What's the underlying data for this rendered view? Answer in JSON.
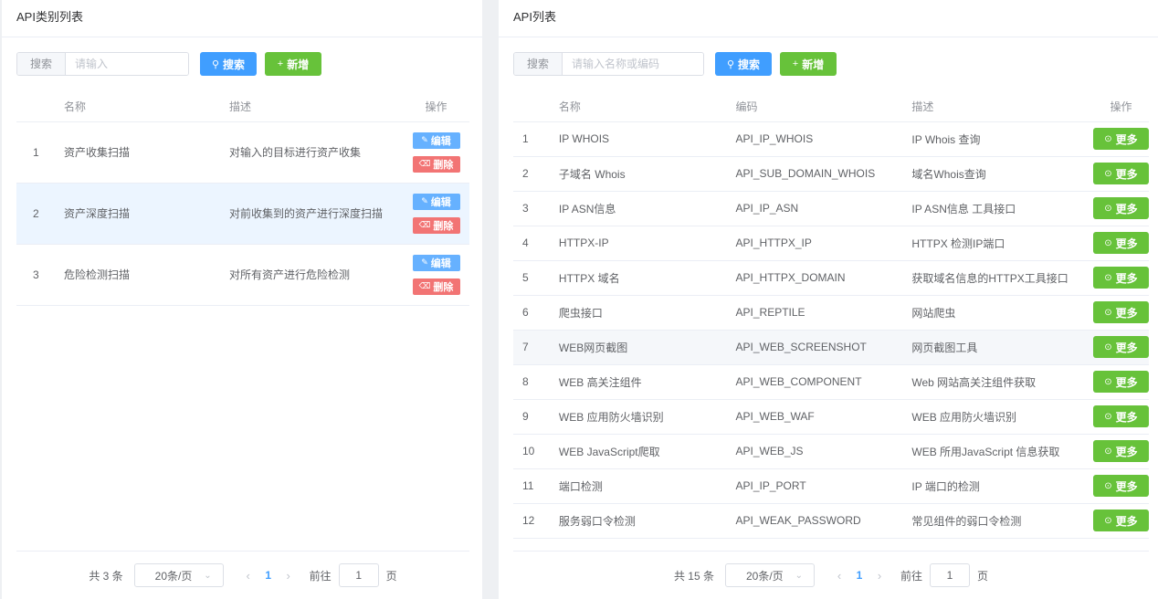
{
  "left": {
    "title": "API类别列表",
    "search": {
      "label": "搜索",
      "placeholder": "请输入",
      "value": ""
    },
    "search_btn": "搜索",
    "add_btn": "新增",
    "columns": [
      "名称",
      "描述",
      "操作"
    ],
    "rows": [
      {
        "idx": "1",
        "name": "资产收集扫描",
        "desc": "对输入的目标进行资产收集"
      },
      {
        "idx": "2",
        "name": "资产深度扫描",
        "desc": "对前收集到的资产进行深度扫描"
      },
      {
        "idx": "3",
        "name": "危险检测扫描",
        "desc": "对所有资产进行危险检测"
      }
    ],
    "edit_label": "编辑",
    "delete_label": "删除",
    "pager": {
      "total": "共 3 条",
      "page_size": "20条/页",
      "current": "1",
      "goto_label": "前往",
      "goto_value": "1",
      "page_suffix": "页"
    }
  },
  "right": {
    "title": "API列表",
    "search": {
      "label": "搜索",
      "placeholder": "请输入名称或编码",
      "value": ""
    },
    "search_btn": "搜索",
    "add_btn": "新增",
    "columns": [
      "名称",
      "编码",
      "描述",
      "操作"
    ],
    "rows": [
      {
        "idx": "1",
        "name": "IP WHOIS",
        "code": "API_IP_WHOIS",
        "desc": "IP Whois 查询"
      },
      {
        "idx": "2",
        "name": "子域名 Whois",
        "code": "API_SUB_DOMAIN_WHOIS",
        "desc": "域名Whois查询"
      },
      {
        "idx": "3",
        "name": "IP ASN信息",
        "code": "API_IP_ASN",
        "desc": "IP ASN信息 工具接口"
      },
      {
        "idx": "4",
        "name": "HTTPX-IP",
        "code": "API_HTTPX_IP",
        "desc": "HTTPX 检测IP端口"
      },
      {
        "idx": "5",
        "name": "HTTPX 域名",
        "code": "API_HTTPX_DOMAIN",
        "desc": "获取域名信息的HTTPX工具接口"
      },
      {
        "idx": "6",
        "name": "爬虫接口",
        "code": "API_REPTILE",
        "desc": "网站爬虫"
      },
      {
        "idx": "7",
        "name": "WEB网页截图",
        "code": "API_WEB_SCREENSHOT",
        "desc": "网页截图工具"
      },
      {
        "idx": "8",
        "name": "WEB 高关注组件",
        "code": "API_WEB_COMPONENT",
        "desc": "Web 网站高关注组件获取"
      },
      {
        "idx": "9",
        "name": "WEB 应用防火墙识别",
        "code": "API_WEB_WAF",
        "desc": "WEB 应用防火墙识别"
      },
      {
        "idx": "10",
        "name": "WEB JavaScript爬取",
        "code": "API_WEB_JS",
        "desc": "WEB 所用JavaScript 信息获取"
      },
      {
        "idx": "11",
        "name": "端口检测",
        "code": "API_IP_PORT",
        "desc": "IP 端口的检测"
      },
      {
        "idx": "12",
        "name": "服务弱口令检测",
        "code": "API_WEAK_PASSWORD",
        "desc": "常见组件的弱口令检测"
      }
    ],
    "more_label": "更多",
    "pager": {
      "total": "共 15 条",
      "page_size": "20条/页",
      "current": "1",
      "goto_label": "前往",
      "goto_value": "1",
      "page_suffix": "页"
    }
  },
  "colors": {
    "primary": "#409eff",
    "success": "#67c23a",
    "danger": "#f27474",
    "edit": "#66b1ff",
    "row_highlight": "#ecf5ff"
  }
}
